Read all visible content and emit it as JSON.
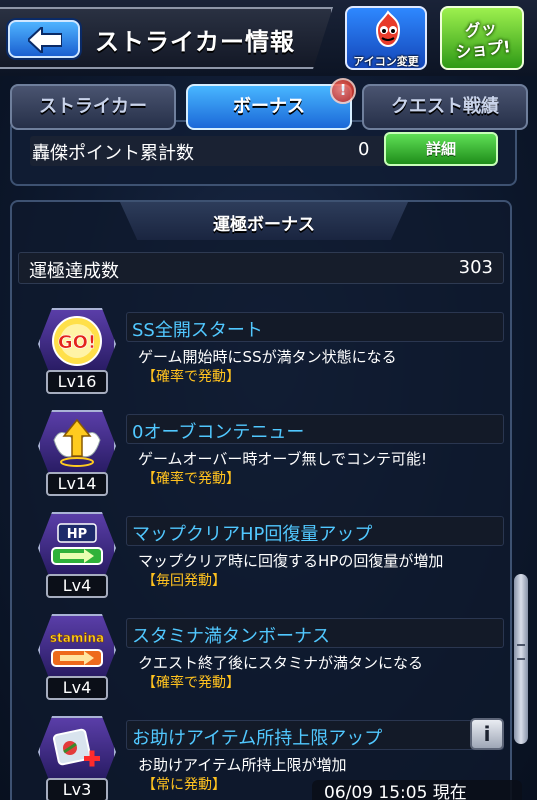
{
  "header": {
    "title": "ストライカー情報",
    "icon_change_label": "アイコン変更",
    "goods_label_line1": "グッ",
    "goods_label_line2": "ショプ!"
  },
  "tabs": [
    {
      "label": "ストライカー",
      "active": false
    },
    {
      "label": "ボーナス",
      "active": true
    },
    {
      "label": "クエスト戦績",
      "active": false
    }
  ],
  "notification": "!",
  "points": {
    "label": "轟傑ポイント累計数",
    "value": "0",
    "detail_button": "詳細"
  },
  "bonus_section": {
    "title": "運極ボーナス",
    "achieve_label": "運極達成数",
    "achieve_value": "303",
    "items": [
      {
        "icon": "go-badge-icon",
        "level": "Lv16",
        "name": "SS全開スタート",
        "desc": "ゲーム開始時にSSが満タン状態になる",
        "trigger": "【確率で発動】"
      },
      {
        "icon": "winged-arrow-icon",
        "level": "Lv14",
        "name": "0オーブコンテニュー",
        "desc": "ゲームオーバー時オーブ無しでコンテ可能!",
        "trigger": "【確率で発動】"
      },
      {
        "icon": "hp-gauge-icon",
        "level": "Lv4",
        "name": "マップクリアHP回復量アップ",
        "desc": "マップクリア時に回復するHPの回復量が増加",
        "trigger": "【毎回発動】"
      },
      {
        "icon": "stamina-gauge-icon",
        "level": "Lv4",
        "name": "スタミナ満タンボーナス",
        "desc": "クエスト終了後にスタミナが満タンになる",
        "trigger": "【確率で発動】"
      },
      {
        "icon": "item-plus-icon",
        "level": "Lv3",
        "name": "お助けアイテム所持上限アップ",
        "desc": "お助けアイテム所持上限が増加",
        "trigger": "【常に発動】"
      }
    ],
    "info_button": "i"
  },
  "timestamp": "06/09 15:05 現在",
  "colors": {
    "accent_blue": "#51c8ff",
    "trigger_yellow": "#ffc21f",
    "tab_active": "#1b68d8"
  }
}
